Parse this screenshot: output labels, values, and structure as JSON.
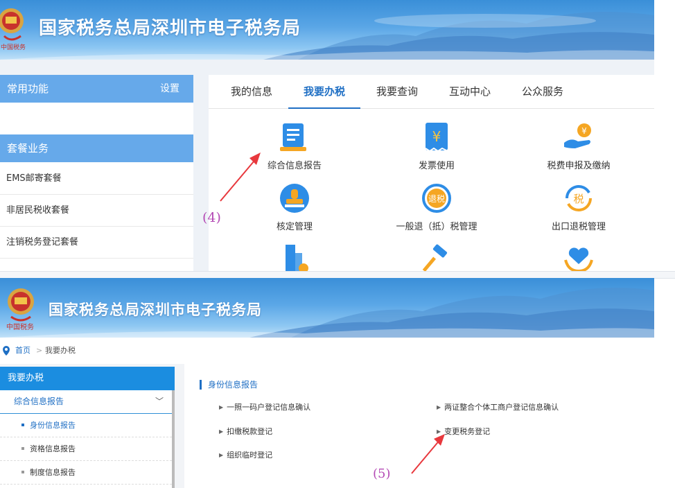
{
  "colors": {
    "primary": "#1f6fc4",
    "sidebar_header": "#66a9ea",
    "sidebar_header_bottom": "#1b8de0",
    "annotation": "#b44ab5",
    "arrow": "#e8383d"
  },
  "top": {
    "site_title": "国家税务总局深圳市电子税务局",
    "sidebar": {
      "common_label": "常用功能",
      "settings_label": "设置",
      "package_label": "套餐业务",
      "items": [
        "EMS邮寄套餐",
        "非居民税收套餐",
        "注销税务登记套餐"
      ]
    },
    "tabs": [
      "我的信息",
      "我要办税",
      "我要查询",
      "互动中心",
      "公众服务"
    ],
    "active_tab": "我要办税",
    "services": [
      {
        "label": "综合信息报告",
        "icon": "report-icon"
      },
      {
        "label": "发票使用",
        "icon": "invoice-icon"
      },
      {
        "label": "税费申报及缴纳",
        "icon": "tax-payment-icon"
      },
      {
        "label": "核定管理",
        "icon": "stamp-icon"
      },
      {
        "label": "一般退（抵）税管理",
        "icon": "tax-refund-icon"
      },
      {
        "label": "出口退税管理",
        "icon": "export-refund-icon"
      },
      {
        "label": "",
        "icon": "building-gear-icon"
      },
      {
        "label": "",
        "icon": "gavel-icon"
      },
      {
        "label": "",
        "icon": "heart-hands-icon"
      }
    ],
    "annotation": "(4)"
  },
  "bottom": {
    "site_title": "国家税务总局深圳市电子税务局",
    "breadcrumb": {
      "home": "首页",
      "separator": ">",
      "current": "我要办税"
    },
    "sidebar": {
      "header": "我要办税",
      "submenu": "综合信息报告",
      "chevron": "﹀",
      "items": [
        {
          "label": "身份信息报告",
          "active": true
        },
        {
          "label": "资格信息报告",
          "active": false
        },
        {
          "label": "制度信息报告",
          "active": false
        }
      ]
    },
    "section_title": "身份信息报告",
    "links": {
      "left": [
        "一照一码户登记信息确认",
        "扣缴税款登记",
        "组织临时登记"
      ],
      "right": [
        "两证整合个体工商户登记信息确认",
        "变更税务登记"
      ]
    },
    "annotation": "(5)"
  }
}
